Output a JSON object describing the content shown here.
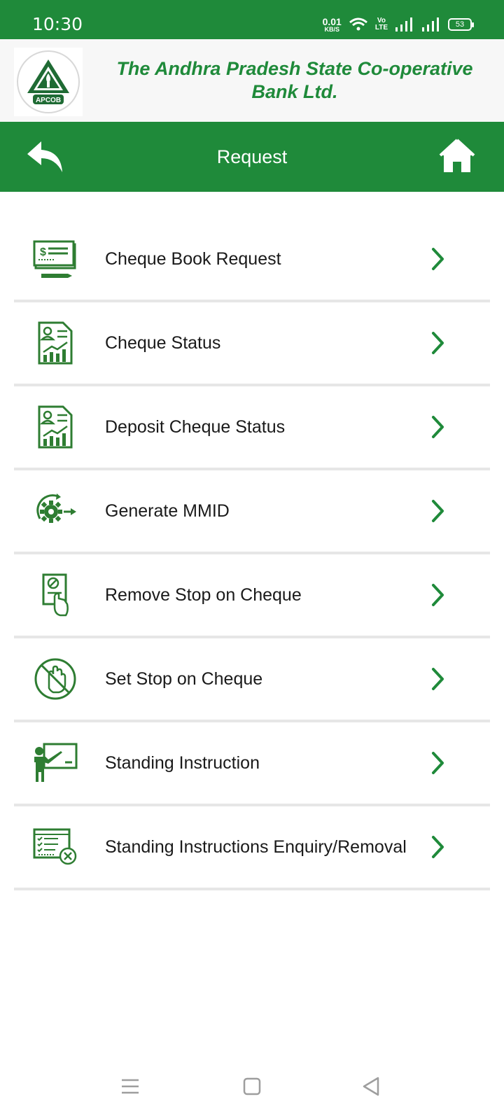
{
  "status_bar": {
    "time": "10:30",
    "net_speed_value": "0.01",
    "net_speed_unit": "KB/S",
    "volte_top": "Vo",
    "volte_bottom": "LTE",
    "battery": "53"
  },
  "bank": {
    "name": "The Andhra Pradesh State Co-operative Bank Ltd.",
    "logo_text": "APCOB"
  },
  "title_bar": {
    "title": "Request",
    "back_icon": "back-arrow-icon",
    "home_icon": "home-icon"
  },
  "menu": {
    "items": [
      {
        "label": "Cheque Book Request",
        "icon": "cheque-book-icon"
      },
      {
        "label": "Cheque Status",
        "icon": "report-chart-icon"
      },
      {
        "label": "Deposit Cheque Status",
        "icon": "report-chart-icon"
      },
      {
        "label": "Generate MMID",
        "icon": "gear-arrow-icon"
      },
      {
        "label": "Remove Stop on Cheque",
        "icon": "document-hand-icon"
      },
      {
        "label": "Set Stop on Cheque",
        "icon": "stop-hand-icon"
      },
      {
        "label": "Standing Instruction",
        "icon": "teacher-board-icon"
      },
      {
        "label": "Standing Instructions Enquiry/Removal",
        "icon": "checklist-remove-icon"
      }
    ]
  },
  "colors": {
    "brand_green": "#1f8a3a",
    "icon_green": "#2e7d32",
    "divider": "#e6e6e6"
  }
}
